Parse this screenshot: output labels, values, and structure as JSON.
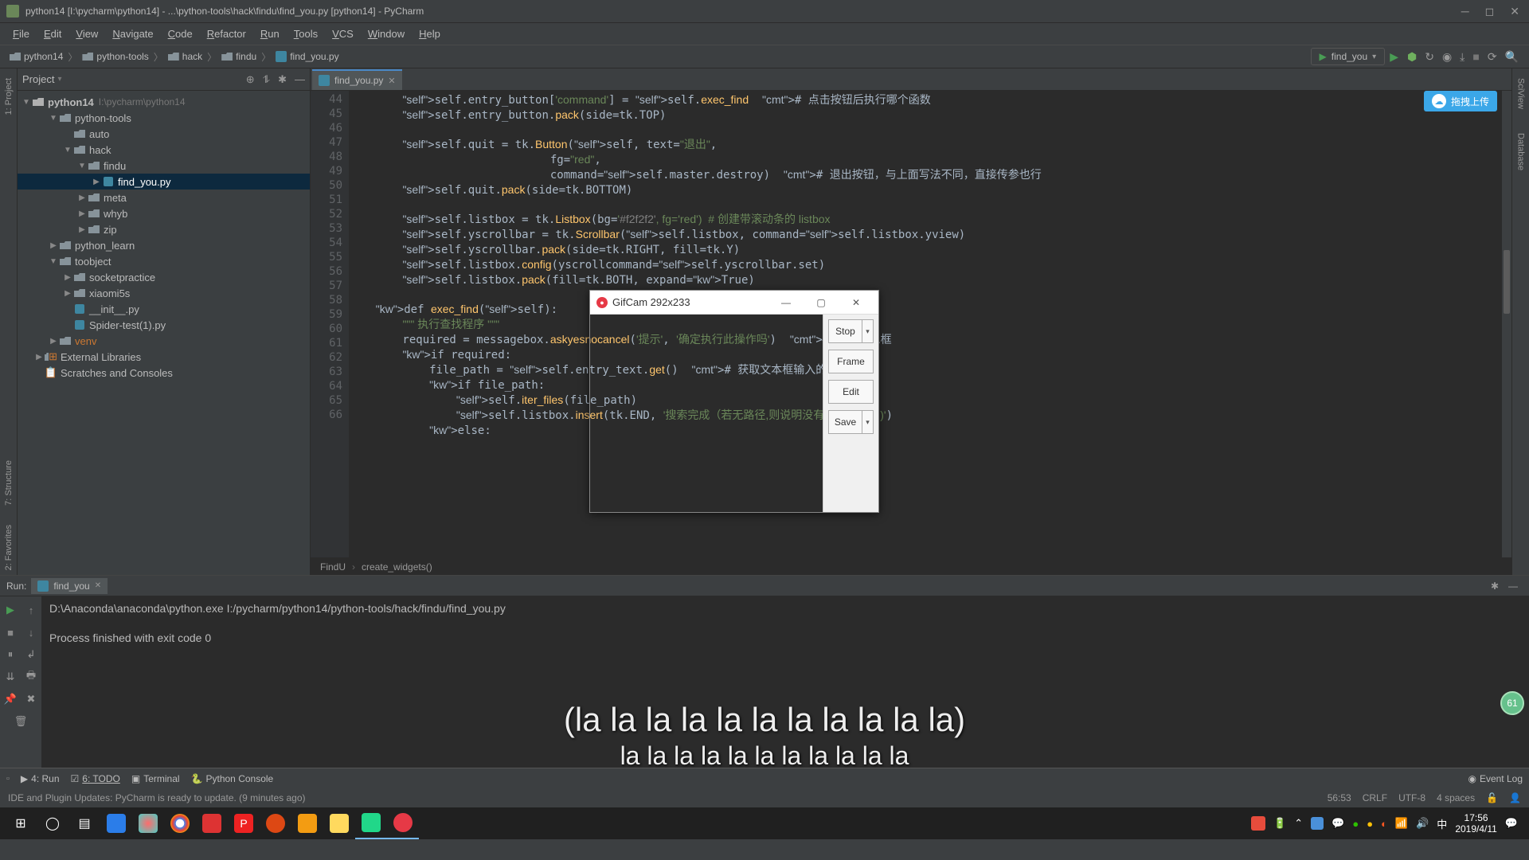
{
  "window": {
    "title": "python14 [I:\\pycharm\\python14] - ...\\python-tools\\hack\\findu\\find_you.py [python14] - PyCharm"
  },
  "menu": [
    "File",
    "Edit",
    "View",
    "Navigate",
    "Code",
    "Refactor",
    "Run",
    "Tools",
    "VCS",
    "Window",
    "Help"
  ],
  "breadcrumbs": [
    "python14",
    "python-tools",
    "hack",
    "findu",
    "find_you.py"
  ],
  "runconfig": "find_you",
  "project": {
    "title": "Project",
    "rootName": "python14",
    "rootPath": "I:\\pycharm\\python14",
    "nodes": [
      {
        "lvl": 1,
        "type": "dir",
        "name": "python-tools",
        "open": true
      },
      {
        "lvl": 2,
        "type": "dir",
        "name": "auto",
        "open": false,
        "leaf": true
      },
      {
        "lvl": 2,
        "type": "dir",
        "name": "hack",
        "open": true
      },
      {
        "lvl": 3,
        "type": "dir",
        "name": "findu",
        "open": true
      },
      {
        "lvl": 4,
        "type": "py",
        "name": "find_you.py",
        "sel": true
      },
      {
        "lvl": 3,
        "type": "dir",
        "name": "meta",
        "open": false
      },
      {
        "lvl": 3,
        "type": "dir",
        "name": "whyb",
        "open": false
      },
      {
        "lvl": 3,
        "type": "dir",
        "name": "zip",
        "open": false
      },
      {
        "lvl": 1,
        "type": "dir",
        "name": "python_learn",
        "open": false
      },
      {
        "lvl": 1,
        "type": "dir",
        "name": "toobject",
        "open": true
      },
      {
        "lvl": 2,
        "type": "dir",
        "name": "socketpractice",
        "open": false
      },
      {
        "lvl": 2,
        "type": "dir",
        "name": "xiaomi5s",
        "open": false
      },
      {
        "lvl": 2,
        "type": "py",
        "name": "__init__.py",
        "leaf": true
      },
      {
        "lvl": 2,
        "type": "py",
        "name": "Spider-test(1).py",
        "leaf": true
      },
      {
        "lvl": 1,
        "type": "dir",
        "name": "venv",
        "open": false,
        "mut": true
      },
      {
        "lvl": 0,
        "type": "lib",
        "name": "External Libraries",
        "open": false
      },
      {
        "lvl": 0,
        "type": "scr",
        "name": "Scratches and Consoles",
        "leaf": true
      }
    ]
  },
  "editor": {
    "tab": "find_you.py",
    "startLine": 44,
    "lines": [
      "        self.entry_button['command'] = self.exec_find  # 点击按钮后执行哪个函数",
      "        self.entry_button.pack(side=tk.TOP)",
      "",
      "        self.quit = tk.Button(self, text=\"退出\",",
      "                              fg=\"red\",",
      "                              command=self.master.destroy)  # 退出按钮，与上面写法不同，直接传参也行",
      "        self.quit.pack(side=tk.BOTTOM)",
      "",
      "        self.listbox = tk.Listbox(bg='#f2f2f2', fg='red')  # 创建带滚动条的 listbox",
      "        self.yscrollbar = tk.Scrollbar(self.listbox, command=self.listbox.yview)",
      "        self.yscrollbar.pack(side=tk.RIGHT, fill=tk.Y)",
      "        self.listbox.config(yscrollcommand=self.yscrollbar.set)",
      "        self.listbox.pack(fill=tk.BOTH, expand=True)",
      "",
      "    def exec_find(self):",
      "        \"\"\" 执行查找程序 \"\"\"",
      "        required = messagebox.askyesnocancel('提示', '确定执行此操作吗')  # 提示消息框",
      "        if required:",
      "            file_path = self.entry_text.get()  # 获取文本框输入的内容",
      "            if file_path:",
      "                self.iter_files(file_path)",
      "                self.listbox.insert(tk.END, '搜索完成（若无路径,则说明没有隐藏文件！)')",
      "            else:"
    ],
    "crumb": [
      "FindU",
      "create_widgets()"
    ]
  },
  "upload": {
    "label": "拖拽上传"
  },
  "run": {
    "label": "Run:",
    "tab": "find_you",
    "out1": "D:\\Anaconda\\anaconda\\python.exe I:/pycharm/python14/python-tools/hack/findu/find_you.py",
    "out2": "Process finished with exit code 0"
  },
  "bottom": {
    "run": "4: Run",
    "todo": "6: TODO",
    "terminal": "Terminal",
    "pyconsole": "Python Console",
    "eventlog": "Event Log"
  },
  "status": {
    "msg": "IDE and Plugin Updates: PyCharm is ready to update. (9 minutes ago)",
    "pos": "56:53",
    "eol": "CRLF",
    "enc": "UTF-8",
    "indent": "4 spaces"
  },
  "gifcam": {
    "title": "GifCam 292x233",
    "buttons": [
      "Stop",
      "Frame",
      "Edit",
      "Save"
    ]
  },
  "subtitle": {
    "l1": "(la la la la la la la la la la la)",
    "l2": "la la la la la la la la la la la"
  },
  "tray": {
    "time": "17:56",
    "date": "2019/4/11"
  },
  "badge": "61"
}
